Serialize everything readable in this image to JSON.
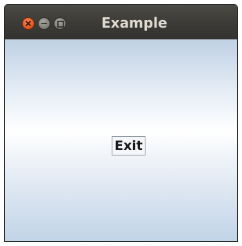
{
  "window": {
    "title": "Example"
  },
  "titlebar": {
    "buttons": [
      {
        "name": "close",
        "icon": "close-icon"
      },
      {
        "name": "minimize",
        "icon": "minimize-icon"
      },
      {
        "name": "maximize",
        "icon": "maximize-icon"
      }
    ],
    "close_color": "#e0541f",
    "button_color": "#7d7c75",
    "background": "#3c3b37"
  },
  "content": {
    "exit_label": "Exit",
    "gradient_top": "#bfd1e4",
    "gradient_middle": "#ffffff",
    "gradient_bottom": "#c0d3e7"
  }
}
